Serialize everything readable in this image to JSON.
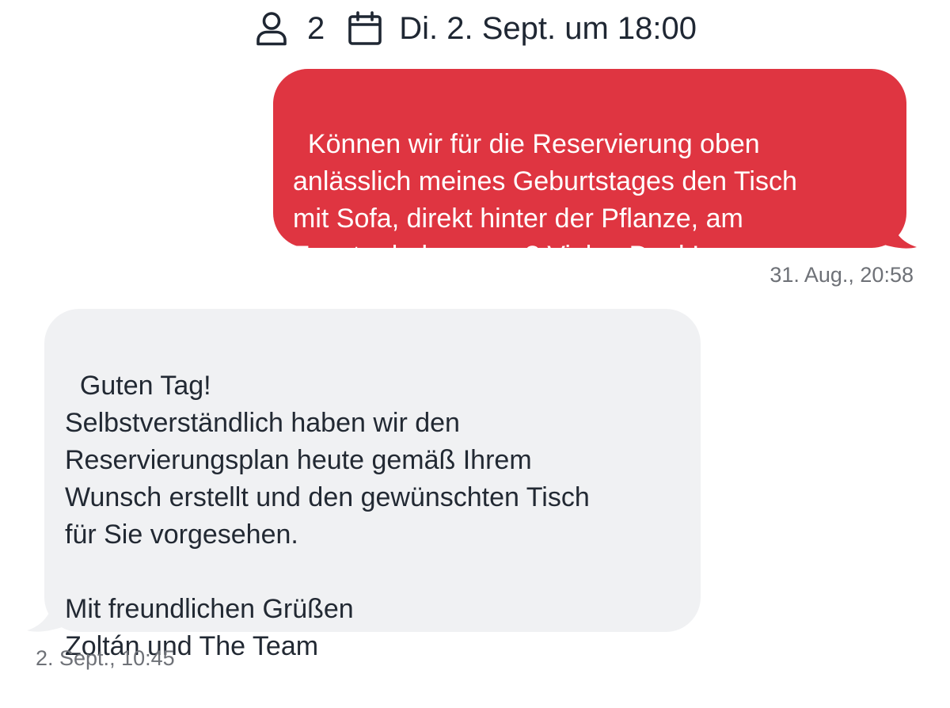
{
  "header": {
    "guests_icon": "person-icon",
    "guests_count": "2",
    "date_icon": "calendar-icon",
    "date_text": "Di. 2. Sept. um 18:00"
  },
  "messages": [
    {
      "direction": "outgoing",
      "text": "Können wir für die Reservierung oben\nanlässlich meines Geburtstages den Tisch\nmit Sofa, direkt hinter der Pflanze, am\nFenster bekommen? Vielen Dank!",
      "timestamp": "31. Aug., 20:58"
    },
    {
      "direction": "incoming",
      "text": "Guten Tag!\nSelbstverständlich haben wir den\nReservierungsplan heute gemäß Ihrem\nWunsch erstellt und den gewünschten Tisch\nfür Sie vorgesehen.\n\nMit freundlichen Grüßen\nZoltán und The Team",
      "timestamp": "2. Sept., 10:45"
    }
  ],
  "colors": {
    "outgoing_bubble": "#df3541",
    "incoming_bubble": "#f0f1f3",
    "header_text": "#1f2733",
    "timestamp_text": "#6e7177"
  }
}
